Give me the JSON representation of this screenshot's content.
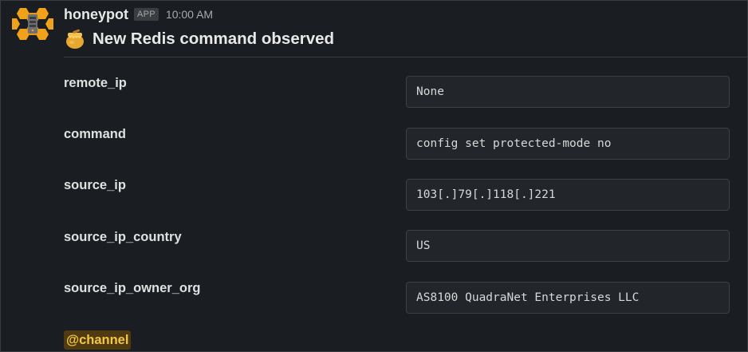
{
  "message": {
    "app_name": "honeypot",
    "app_badge": "APP",
    "timestamp": "10:00 AM",
    "title": "New Redis command observed",
    "title_icon": "honey-pot-icon",
    "avatar_icon": "honeypot-avatar-icon",
    "fields": [
      {
        "label": "remote_ip",
        "value": "None"
      },
      {
        "label": "command",
        "value": "config set protected-mode no"
      },
      {
        "label": "source_ip",
        "value": "103[.]79[.]118[.]221"
      },
      {
        "label": "source_ip_country",
        "value": "US"
      },
      {
        "label": "source_ip_owner_org",
        "value": "AS8100 QuadraNet Enterprises LLC"
      }
    ],
    "mention": "@channel"
  },
  "colors": {
    "background": "#1a1d21",
    "text_primary": "#e8e8e8",
    "field_box": "#222529",
    "mention_bg": "#4f3a12",
    "mention_text": "#f2c744",
    "honeycomb": "#f0a21b"
  }
}
